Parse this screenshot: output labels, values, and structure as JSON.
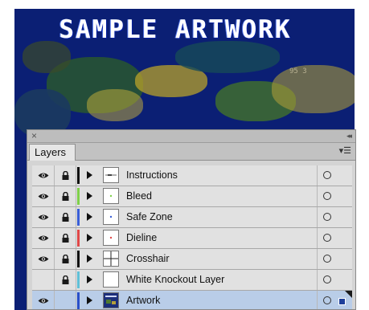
{
  "artwork": {
    "title": "SAMPLE ARTWORK",
    "code": "95 3"
  },
  "panel": {
    "close_glyph": "×",
    "collapse_glyph": "◂◂",
    "tab_label": "Layers",
    "menu_glyph": "▾☰",
    "layers": [
      {
        "name": "Instructions",
        "visible": true,
        "locked": true,
        "color": "#111111",
        "thumb": "instructions",
        "selected": false
      },
      {
        "name": "Bleed",
        "visible": true,
        "locked": true,
        "color": "#7fd04a",
        "thumb": "bleed",
        "selected": false
      },
      {
        "name": "Safe Zone",
        "visible": true,
        "locked": true,
        "color": "#3a5fd8",
        "thumb": "safe",
        "selected": false
      },
      {
        "name": "Dieline",
        "visible": true,
        "locked": true,
        "color": "#e04848",
        "thumb": "dieline",
        "selected": false
      },
      {
        "name": "Crosshair",
        "visible": true,
        "locked": true,
        "color": "#111111",
        "thumb": "crosshair",
        "selected": false
      },
      {
        "name": "White Knockout Layer",
        "visible": false,
        "locked": true,
        "color": "#5fc0d8",
        "thumb": "blank",
        "selected": false
      },
      {
        "name": "Artwork",
        "visible": true,
        "locked": false,
        "color": "#2a4fc8",
        "thumb": "artwork",
        "selected": true
      }
    ]
  }
}
